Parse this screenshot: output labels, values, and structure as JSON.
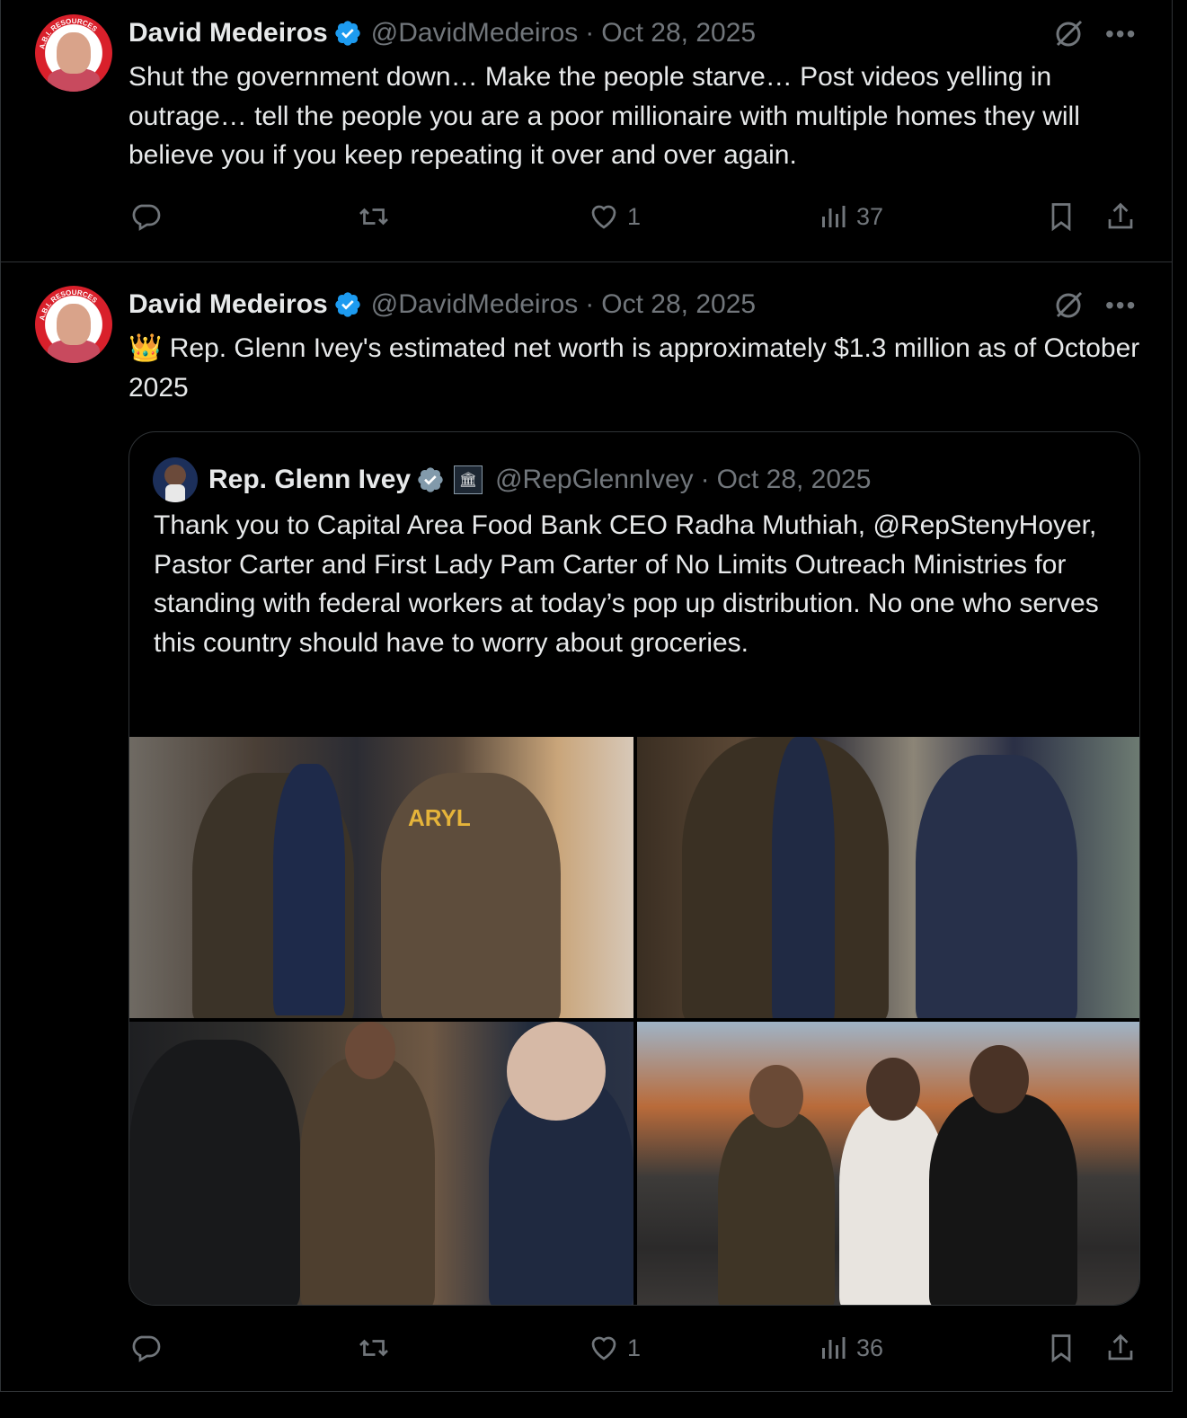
{
  "tweets": [
    {
      "name": "David Medeiros",
      "handle": "@DavidMedeiros",
      "separator": "·",
      "date": "Oct 28, 2025",
      "avatar_ring_text": "A.B.I. RESOURCES",
      "text": "Shut the government down… Make the people starve… Post videos yelling in outrage… tell the people you are a poor millionaire with multiple homes they will believe you if you keep repeating it over and over again.",
      "actions": {
        "reply_count": "",
        "repost_count": "",
        "like_count": "1",
        "view_count": "37"
      }
    },
    {
      "name": "David Medeiros",
      "handle": "@DavidMedeiros",
      "separator": "·",
      "date": "Oct 28, 2025",
      "avatar_ring_text": "A.B.I. RESOURCES",
      "emoji": "👑",
      "text": "Rep. Glenn Ivey's estimated net worth is approximately $1.3 million as of October 2025",
      "quote": {
        "name": "Rep. Glenn Ivey",
        "handle": "@RepGlennIvey",
        "separator": "·",
        "date": "Oct 28, 2025",
        "text": "Thank you to Capital Area Food Bank CEO Radha Muthiah, @RepStenyHoyer, Pastor Carter and First Lady Pam Carter of No Limits Outreach Ministries for standing with federal workers at today’s pop up distribution. No one who serves this country should have to worry about groceries.",
        "photo_text": "ARYL"
      },
      "actions": {
        "reply_count": "",
        "repost_count": "",
        "like_count": "1",
        "view_count": "36"
      }
    }
  ],
  "colors": {
    "background": "#000000",
    "text": "#e7e9ea",
    "muted": "#71767b",
    "verified": "#1d9bf0",
    "border": "#2f3336"
  },
  "icons": [
    "verified-badge-icon",
    "grok-icon",
    "more-icon",
    "reply-icon",
    "repost-icon",
    "like-icon",
    "views-icon",
    "bookmark-icon",
    "share-icon",
    "government-badge-icon"
  ]
}
